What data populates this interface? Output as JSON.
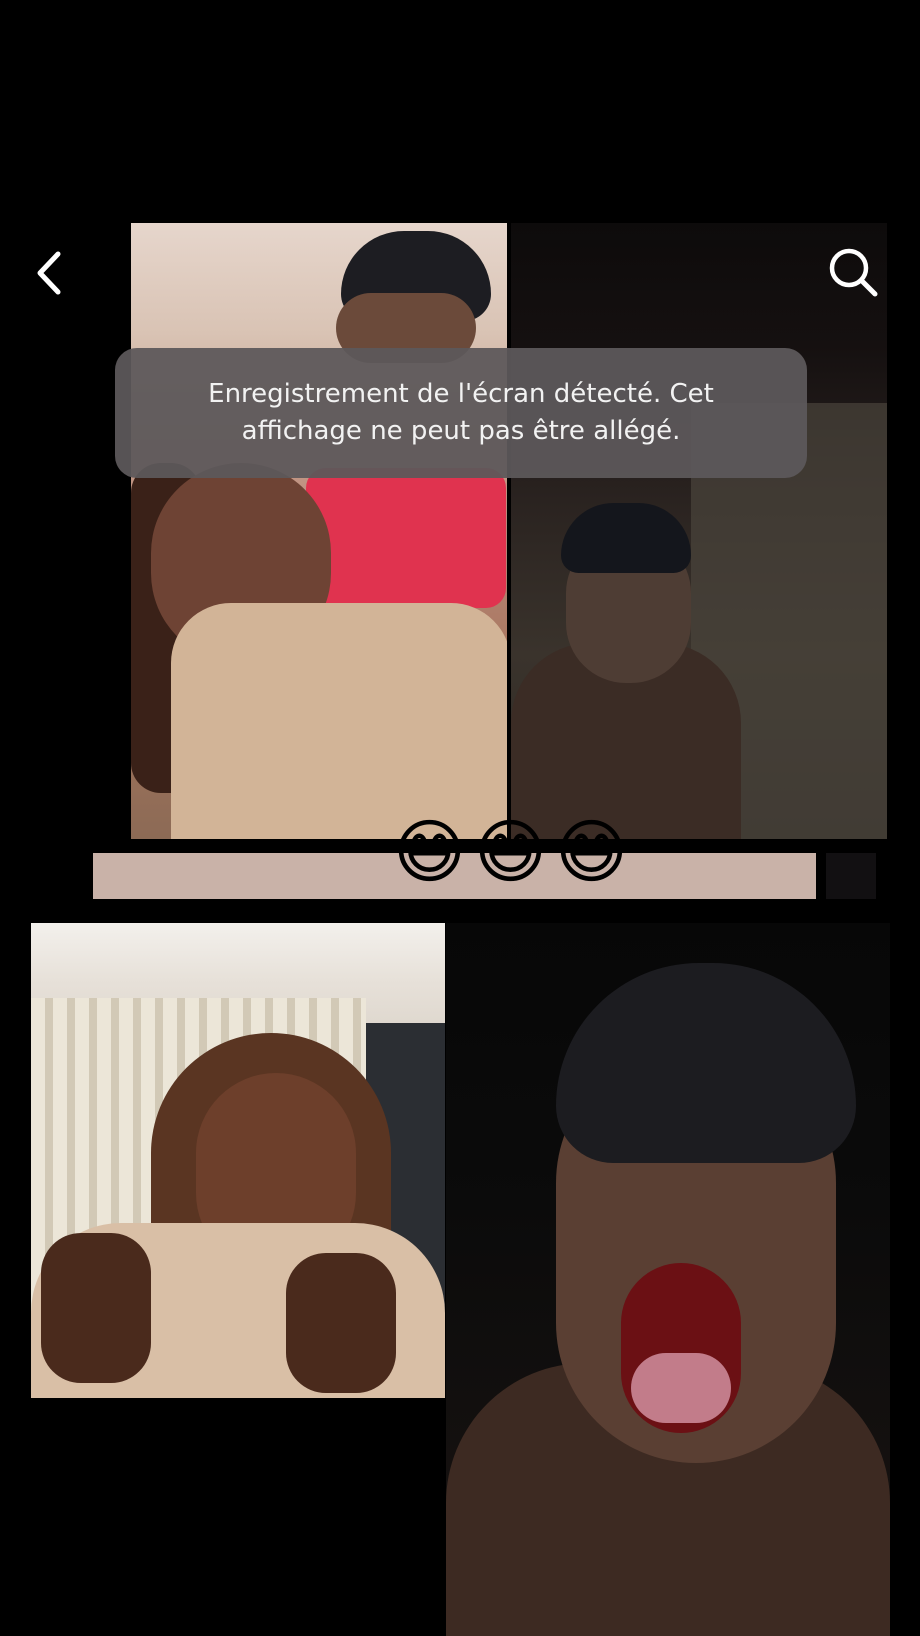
{
  "toast": {
    "message": "Enregistrement de l'écran détecté. Cet affichage ne peut pas être allégé."
  },
  "nav": {
    "back_icon": "chevron-left-icon",
    "search_icon": "search-icon"
  },
  "emoji_bar": {
    "emojis": [
      "😅",
      "😅",
      "😅"
    ]
  },
  "colors": {
    "background": "#000000",
    "toast_bg": "#5c585a",
    "toast_text": "#f2f2f2",
    "bar": "#c9b2a8"
  }
}
